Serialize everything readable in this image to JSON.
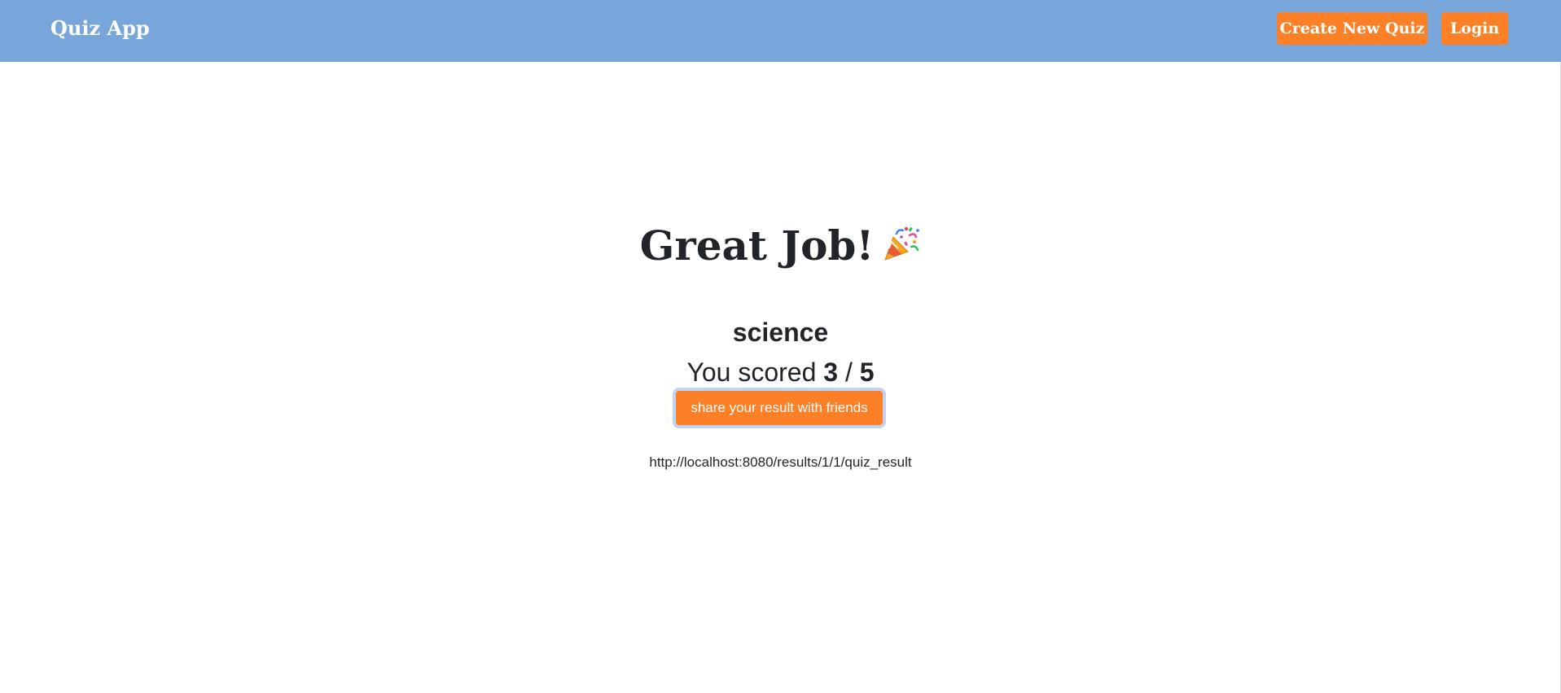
{
  "navbar": {
    "brand": "Quiz App",
    "create_quiz_label": "Create New Quiz",
    "login_label": "Login",
    "background_color": "#78a6db",
    "accent_color": "#fd8027"
  },
  "result": {
    "heading": "Great Job!",
    "heading_icon": "party-popper-icon",
    "quiz_name": "science",
    "score_prefix": "You scored",
    "score": "3",
    "separator": "/",
    "total": "5",
    "share_button_label": "share your result with friends",
    "share_url": "http://localhost:8080/results/1/1/quiz_result"
  }
}
